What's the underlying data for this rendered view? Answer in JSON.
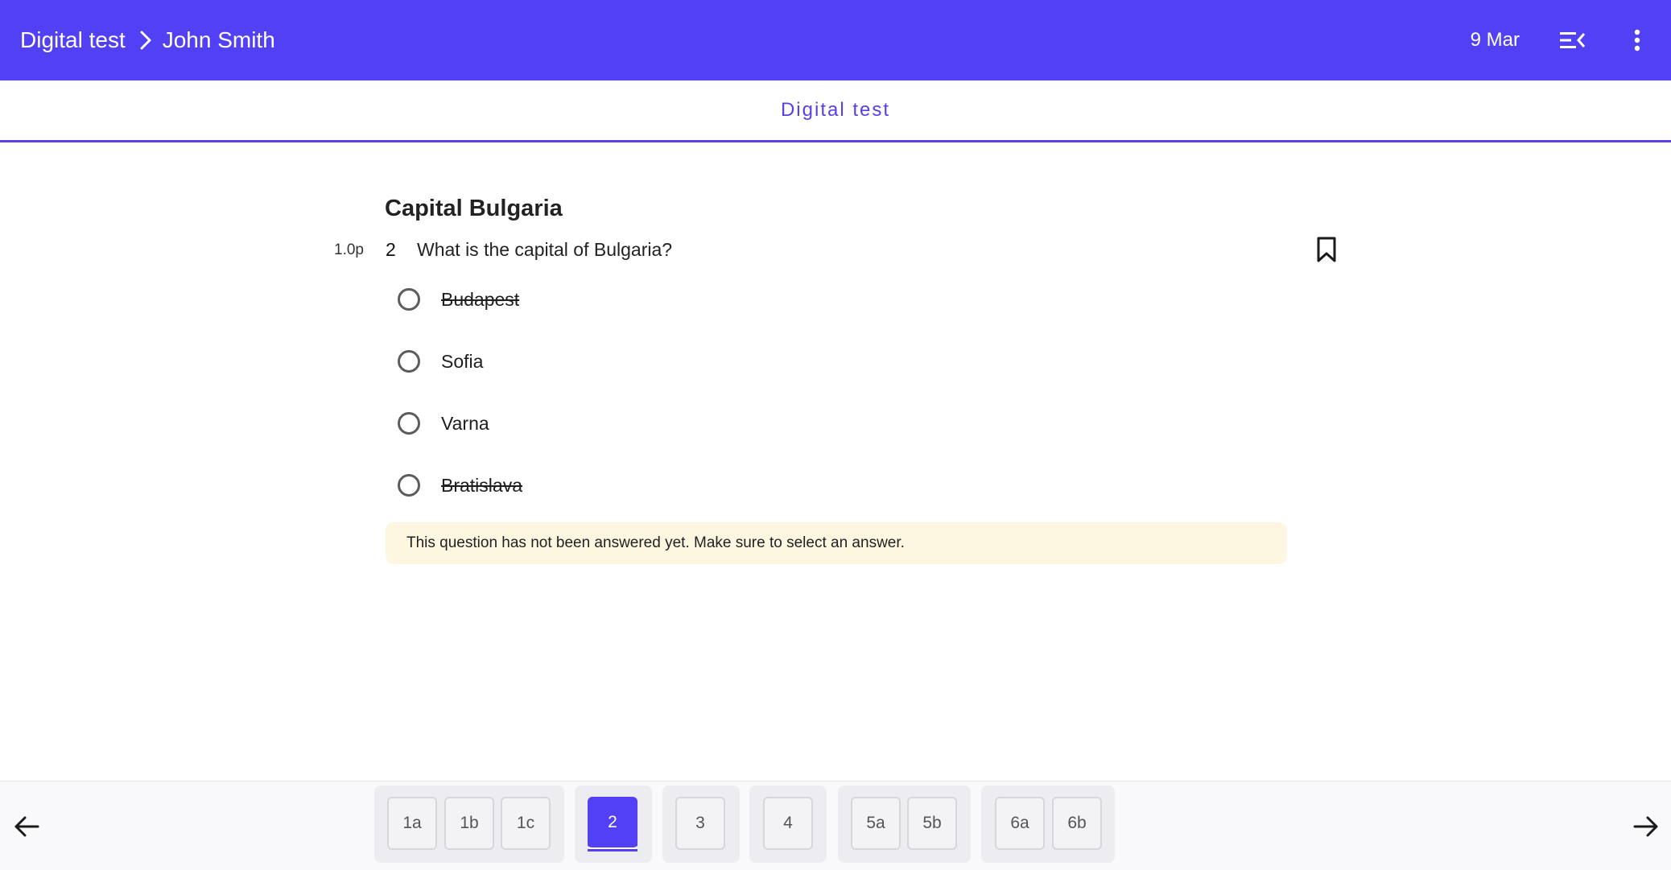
{
  "header": {
    "breadcrumb_app": "Digital test",
    "breadcrumb_student": "John Smith",
    "date": "9 Mar"
  },
  "subheader": {
    "title": "Digital test"
  },
  "question": {
    "section_title": "Capital Bulgaria",
    "points": "1.0p",
    "number": "2",
    "text": "What is the capital of Bulgaria?",
    "options": [
      {
        "label": "Budapest",
        "struck": true
      },
      {
        "label": "Sofia",
        "struck": false
      },
      {
        "label": "Varna",
        "struck": false
      },
      {
        "label": "Bratislava",
        "struck": true
      }
    ],
    "notice": "This question has not been answered yet. Make sure to select an answer."
  },
  "navigation": {
    "groups": [
      [
        "1a",
        "1b",
        "1c"
      ],
      [
        "2"
      ],
      [
        "3"
      ],
      [
        "4"
      ],
      [
        "5a",
        "5b"
      ],
      [
        "6a",
        "6b"
      ]
    ],
    "active": "2"
  },
  "colors": {
    "brand": "#5240f5",
    "notice_bg": "#fdf6e1"
  }
}
